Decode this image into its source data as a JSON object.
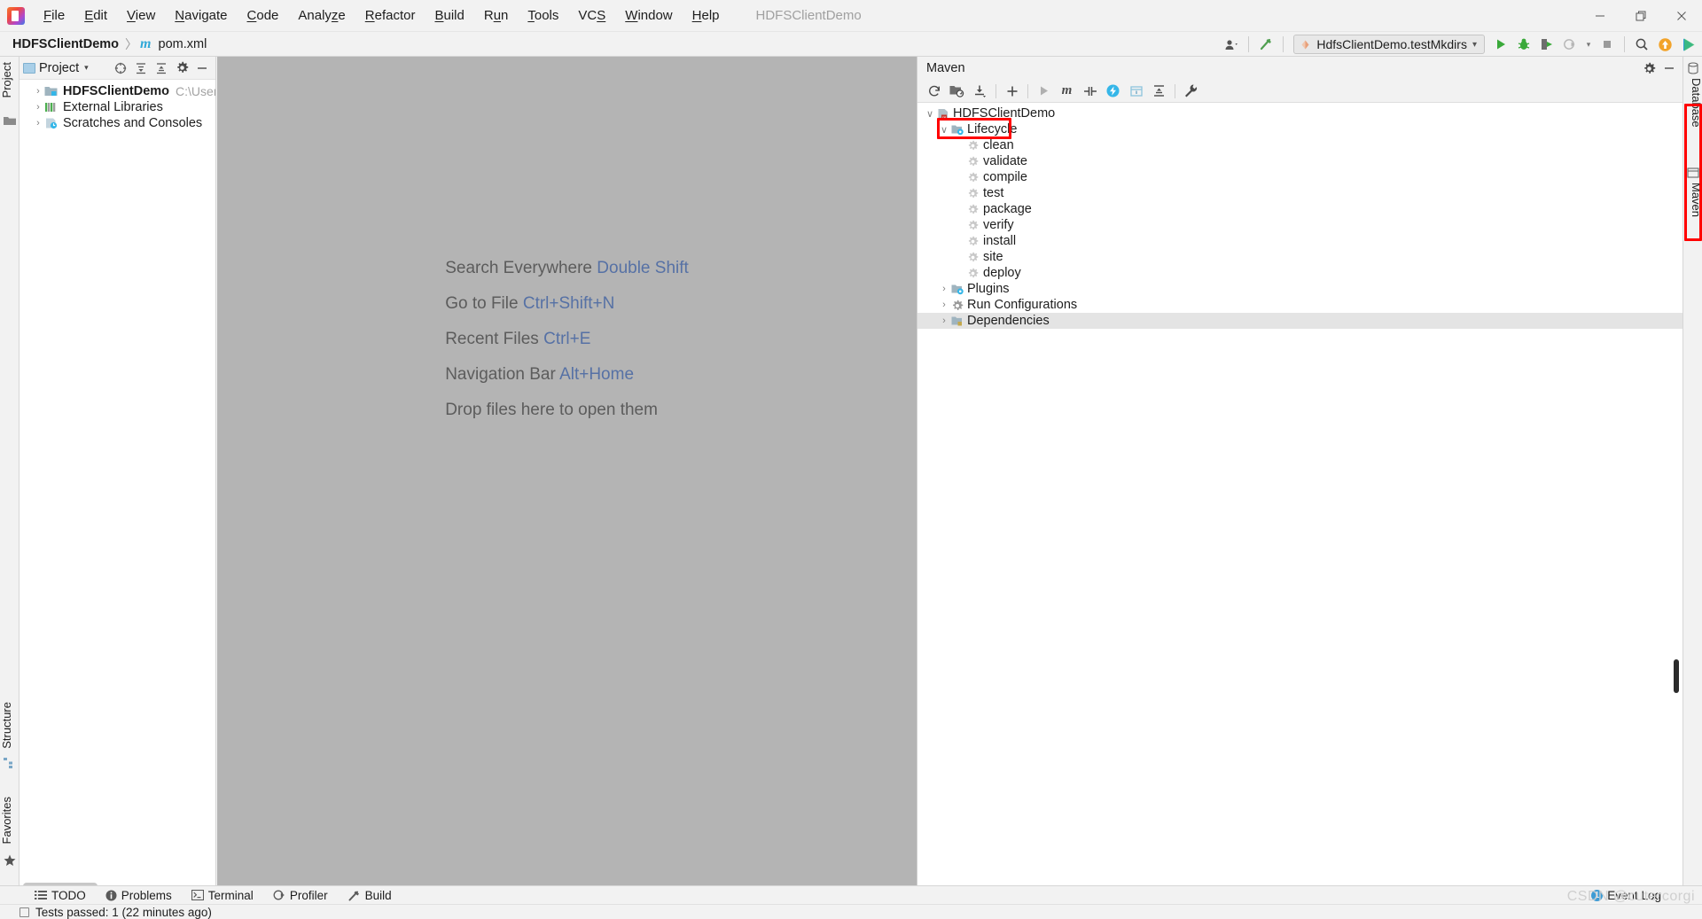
{
  "window": {
    "title": "HDFSClientDemo",
    "app_icon": "intellij-idea-logo",
    "controls": {
      "minimize": "─",
      "maximize": "❐",
      "close": "✕"
    }
  },
  "menubar": {
    "items": [
      {
        "label": "File",
        "mnemonic": "F"
      },
      {
        "label": "Edit",
        "mnemonic": "E"
      },
      {
        "label": "View",
        "mnemonic": "V"
      },
      {
        "label": "Navigate",
        "mnemonic": "N"
      },
      {
        "label": "Code",
        "mnemonic": "C"
      },
      {
        "label": "Analyze",
        "mnemonic": "z"
      },
      {
        "label": "Refactor",
        "mnemonic": "R"
      },
      {
        "label": "Build",
        "mnemonic": "B"
      },
      {
        "label": "Run",
        "mnemonic": "u"
      },
      {
        "label": "Tools",
        "mnemonic": "T"
      },
      {
        "label": "VCS",
        "mnemonic": "S"
      },
      {
        "label": "Window",
        "mnemonic": "W"
      },
      {
        "label": "Help",
        "mnemonic": "H"
      }
    ]
  },
  "navbar": {
    "breadcrumb": [
      {
        "label": "HDFSClientDemo",
        "icon": "",
        "bold": true
      },
      {
        "label": "pom.xml",
        "icon": "maven-m-icon",
        "bold": false
      }
    ],
    "separator": "〉",
    "run_config": {
      "label": "HdfsClientDemo.testMkdirs",
      "icon": "run-config-icon",
      "dropdown": "∨"
    },
    "buttons": [
      {
        "name": "user-avatar-button",
        "label": ""
      },
      {
        "name": "build-hammer-button",
        "label": ""
      },
      {
        "name": "run-button",
        "label": ""
      },
      {
        "name": "debug-button",
        "label": ""
      },
      {
        "name": "run-with-coverage-button",
        "label": ""
      },
      {
        "name": "profile-button",
        "label": ""
      },
      {
        "name": "stop-button",
        "label": ""
      },
      {
        "name": "search-everywhere-button",
        "label": ""
      },
      {
        "name": "update-project-button",
        "label": ""
      },
      {
        "name": "idea-play-button",
        "label": ""
      }
    ]
  },
  "left_strip": {
    "items": [
      {
        "label": "Project",
        "name": "tool-window-project"
      },
      {
        "label": "Structure",
        "name": "tool-window-structure"
      },
      {
        "label": "Favorites",
        "name": "tool-window-favorites"
      }
    ]
  },
  "right_strip": {
    "items": [
      {
        "label": "Database",
        "name": "tool-window-database"
      },
      {
        "label": "Maven",
        "name": "tool-window-maven"
      }
    ]
  },
  "project_panel": {
    "title": "Project",
    "dropdown_caret": "▾",
    "actions": [
      {
        "name": "locate-in-tree-button"
      },
      {
        "name": "expand-all-button"
      },
      {
        "name": "collapse-all-button"
      },
      {
        "name": "settings-gear-button"
      },
      {
        "name": "hide-panel-button"
      }
    ],
    "tree": [
      {
        "label": "HDFSClientDemo",
        "path": "C:\\Users\\LENOVO",
        "icon": "module-icon",
        "arrow": "›",
        "bold": true
      },
      {
        "label": "External Libraries",
        "path": "",
        "icon": "libraries-icon",
        "arrow": "›",
        "bold": false
      },
      {
        "label": "Scratches and Consoles",
        "path": "",
        "icon": "scratches-icon",
        "arrow": "›",
        "bold": false
      }
    ]
  },
  "editor": {
    "tips": [
      {
        "action": "Search Everywhere",
        "shortcut": "Double Shift"
      },
      {
        "action": "Go to File",
        "shortcut": "Ctrl+Shift+N"
      },
      {
        "action": "Recent Files",
        "shortcut": "Ctrl+E"
      },
      {
        "action": "Navigation Bar",
        "shortcut": "Alt+Home"
      },
      {
        "action": "Drop files here to open them",
        "shortcut": ""
      }
    ]
  },
  "maven_panel": {
    "title": "Maven",
    "actions": [
      {
        "name": "maven-settings-button"
      },
      {
        "name": "maven-hide-button"
      }
    ],
    "toolbar": [
      {
        "name": "reload-all-projects-button",
        "icon": "refresh-icon"
      },
      {
        "name": "generate-sources-button",
        "icon": "folder-refresh-icon"
      },
      {
        "name": "download-sources-button",
        "icon": "download-icon"
      },
      {
        "name": "add-maven-project-button",
        "icon": "plus-icon"
      },
      {
        "name": "run-maven-build-button",
        "icon": "play-icon"
      },
      {
        "name": "execute-maven-goal-button",
        "icon": "m-icon"
      },
      {
        "name": "toggle-offline-mode-button",
        "icon": "offline-icon"
      },
      {
        "name": "skip-tests-button",
        "icon": "skip-tests-icon"
      },
      {
        "name": "show-dependencies-button",
        "icon": "dependencies-icon"
      },
      {
        "name": "collapse-all-button",
        "icon": "collapse-icon"
      },
      {
        "name": "maven-settings-wrench-button",
        "icon": "wrench-icon"
      }
    ],
    "tree": {
      "root": {
        "label": "HDFSClientDemo",
        "arrow": "∨",
        "icon": "maven-project-icon"
      },
      "lifecycle": {
        "label": "Lifecycle",
        "arrow": "∨",
        "icon": "lifecycle-folder-icon",
        "highlighted": true,
        "highlight_color": "#ff0000",
        "goals": [
          {
            "label": "clean",
            "icon": "goal-gear-icon"
          },
          {
            "label": "validate",
            "icon": "goal-gear-icon"
          },
          {
            "label": "compile",
            "icon": "goal-gear-icon"
          },
          {
            "label": "test",
            "icon": "goal-gear-icon"
          },
          {
            "label": "package",
            "icon": "goal-gear-icon"
          },
          {
            "label": "verify",
            "icon": "goal-gear-icon"
          },
          {
            "label": "install",
            "icon": "goal-gear-icon"
          },
          {
            "label": "site",
            "icon": "goal-gear-icon"
          },
          {
            "label": "deploy",
            "icon": "goal-gear-icon"
          }
        ]
      },
      "nodes": [
        {
          "label": "Plugins",
          "arrow": "›",
          "icon": "plugins-folder-icon",
          "selected": false
        },
        {
          "label": "Run Configurations",
          "arrow": "›",
          "icon": "run-config-gear-icon",
          "selected": false
        },
        {
          "label": "Dependencies",
          "arrow": "›",
          "icon": "dependencies-folder-icon",
          "selected": true
        }
      ]
    }
  },
  "bottom_tools": {
    "items": [
      {
        "label": "TODO",
        "icon": "todo-list-icon",
        "name": "tool-window-todo"
      },
      {
        "label": "Problems",
        "icon": "problems-icon",
        "name": "tool-window-problems"
      },
      {
        "label": "Terminal",
        "icon": "terminal-icon",
        "name": "tool-window-terminal"
      },
      {
        "label": "Profiler",
        "icon": "profiler-icon",
        "name": "tool-window-profiler"
      },
      {
        "label": "Build",
        "icon": "build-hammer-icon",
        "name": "tool-window-build"
      }
    ]
  },
  "statusbar": {
    "message": "Tests passed: 1 (22 minutes ago)",
    "event_log": {
      "label": "Event Log",
      "badge": "1"
    }
  },
  "watermark": "CSDN @cutercorgi"
}
